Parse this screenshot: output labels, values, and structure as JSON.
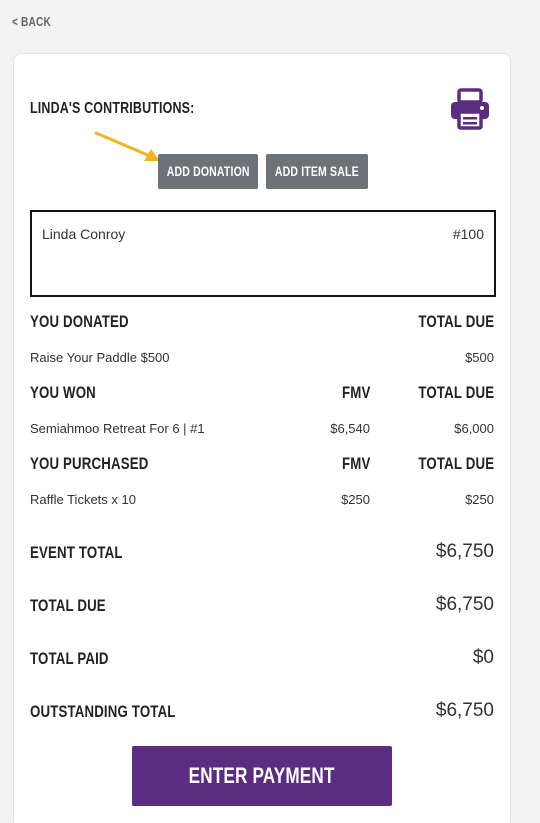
{
  "nav": {
    "back_label": "< BACK"
  },
  "header": {
    "title": "LINDA'S CONTRIBUTIONS:",
    "print_icon": "printer-icon"
  },
  "actions": {
    "add_donation_label": "ADD DONATION",
    "add_item_sale_label": "ADD ITEM SALE"
  },
  "bidder": {
    "name": "Linda Conroy",
    "number": "#100"
  },
  "donated": {
    "heading": "YOU DONATED",
    "total_due_header": "TOTAL DUE",
    "items": [
      {
        "name": "Raise Your Paddle $500",
        "total_due": "$500"
      }
    ]
  },
  "won": {
    "heading": "YOU WON",
    "fmv_header": "FMV",
    "total_due_header": "TOTAL DUE",
    "items": [
      {
        "name": "Semiahmoo Retreat For 6 | #1",
        "fmv": "$6,540",
        "total_due": "$6,000"
      }
    ]
  },
  "purchased": {
    "heading": "YOU PURCHASED",
    "fmv_header": "FMV",
    "total_due_header": "TOTAL DUE",
    "items": [
      {
        "name": "Raffle Tickets x 10",
        "fmv": "$250",
        "total_due": "$250"
      }
    ]
  },
  "summary": {
    "event_total_label": "EVENT TOTAL",
    "event_total": "$6,750",
    "total_due_label": "TOTAL DUE",
    "total_due": "$6,750",
    "total_paid_label": "TOTAL PAID",
    "total_paid": "$0",
    "outstanding_label": "OUTSTANDING TOTAL",
    "outstanding": "$6,750"
  },
  "payment": {
    "button_label": "ENTER PAYMENT"
  },
  "colors": {
    "primary": "#5b2d80",
    "button_gray": "#6b7378",
    "arrow": "#f0b323"
  }
}
